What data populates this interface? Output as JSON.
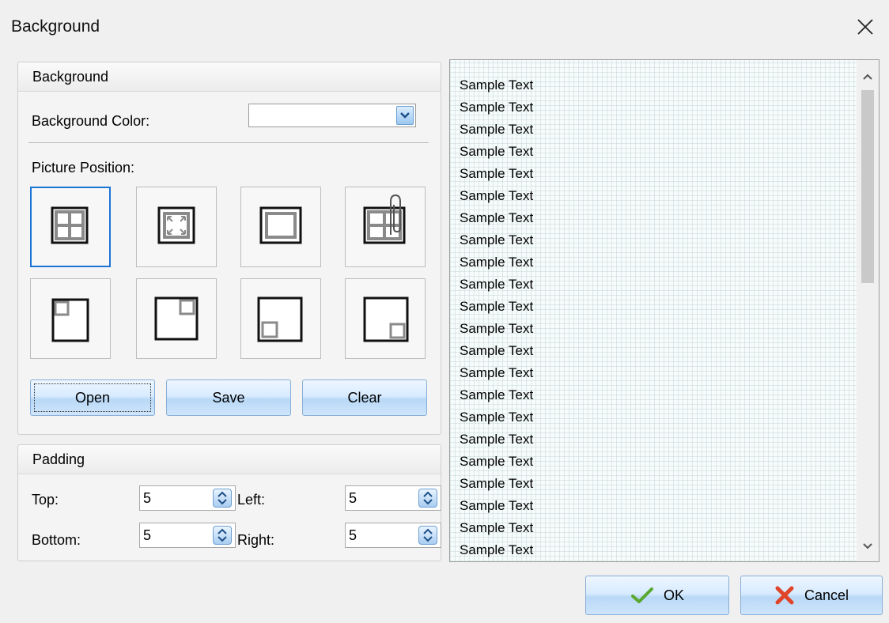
{
  "window": {
    "title": "Background",
    "close_icon": "close-icon"
  },
  "background_group": {
    "header": "Background",
    "color_label": "Background Color:",
    "color_value": "",
    "position_label": "Picture Position:",
    "positions": [
      {
        "icon": "tile-icon",
        "selected": true
      },
      {
        "icon": "stretch-icon",
        "selected": false
      },
      {
        "icon": "center-icon",
        "selected": false
      },
      {
        "icon": "attached-icon",
        "selected": false
      },
      {
        "icon": "top-left-icon",
        "selected": false
      },
      {
        "icon": "top-right-icon",
        "selected": false
      },
      {
        "icon": "bottom-left-icon",
        "selected": false
      },
      {
        "icon": "bottom-right-icon",
        "selected": false
      }
    ],
    "buttons": {
      "open": "Open",
      "save": "Save",
      "clear": "Clear"
    }
  },
  "padding_group": {
    "header": "Padding",
    "top_label": "Top:",
    "top_value": "5",
    "left_label": "Left:",
    "left_value": "5",
    "bottom_label": "Bottom:",
    "bottom_value": "5",
    "right_label": "Right:",
    "right_value": "5"
  },
  "preview": {
    "lines": [
      "Sample Text",
      "Sample Text",
      "Sample Text",
      "Sample Text",
      "Sample Text",
      "Sample Text",
      "Sample Text",
      "Sample Text",
      "Sample Text",
      "Sample Text",
      "Sample Text",
      "Sample Text",
      "Sample Text",
      "Sample Text",
      "Sample Text",
      "Sample Text",
      "Sample Text",
      "Sample Text",
      "Sample Text",
      "Sample Text",
      "Sample Text",
      "Sample Text"
    ]
  },
  "dialog_buttons": {
    "ok": "OK",
    "cancel": "Cancel"
  },
  "colors": {
    "accent": "#1a74d6",
    "ok_check": "#5aa832",
    "cancel_x": "#e0452a"
  }
}
